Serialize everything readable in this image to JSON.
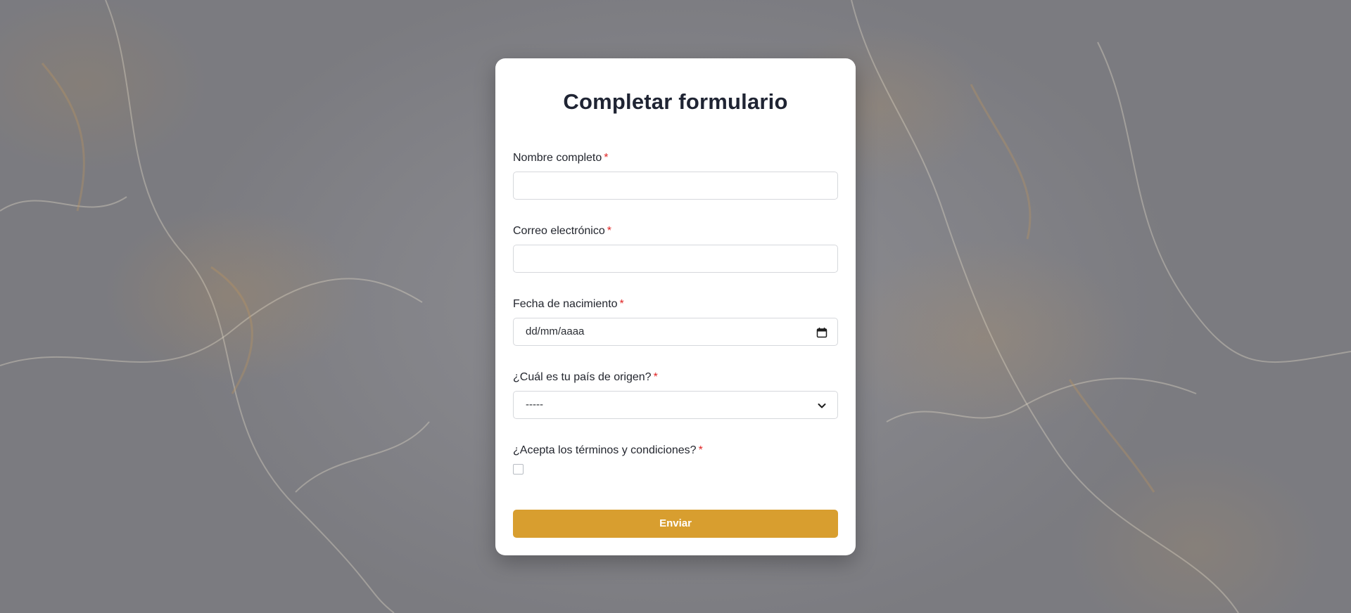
{
  "form": {
    "title": "Completar formulario",
    "required_marker": "*",
    "fields": [
      {
        "label": "Nombre completo",
        "value": ""
      },
      {
        "label": "Correo electrónico",
        "value": ""
      },
      {
        "label": "Fecha de nacimiento",
        "placeholder": "dd/mm/aaaa",
        "icon": "calendar-icon"
      },
      {
        "label": "¿Cuál es tu país de origen?",
        "selected": "-----",
        "icon": "chevron-down-icon"
      },
      {
        "label": "¿Acepta los términos y condiciones?",
        "checked": false
      }
    ],
    "submit_label": "Enviar"
  },
  "colors": {
    "accent": "#d89e2f",
    "required": "#e02424",
    "title": "#1f2433"
  }
}
